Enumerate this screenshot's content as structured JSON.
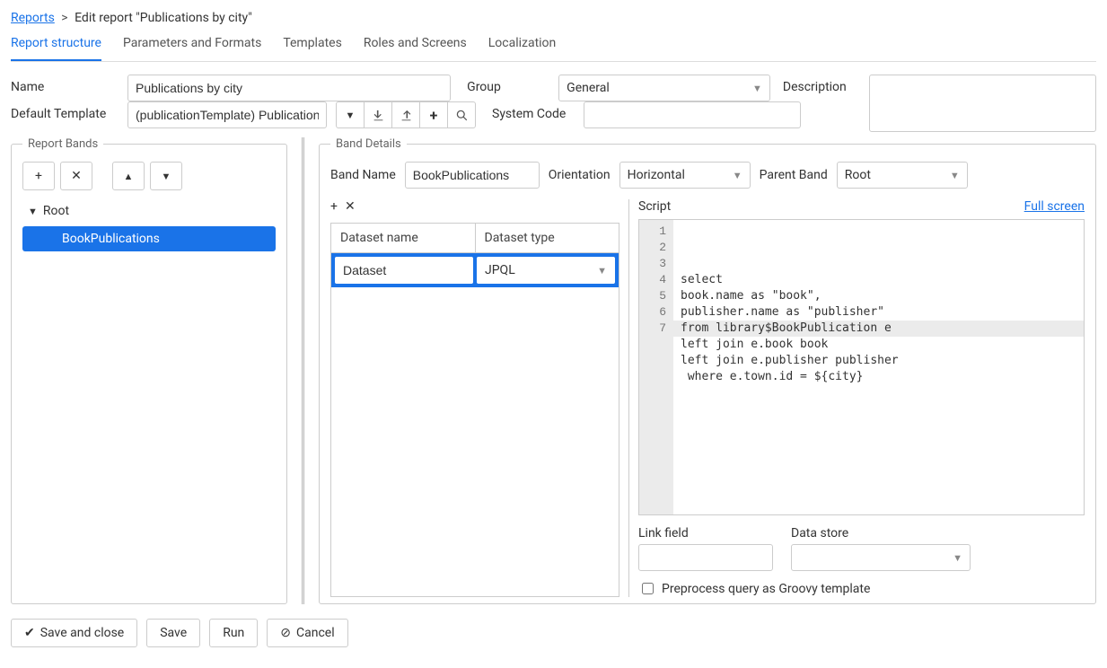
{
  "breadcrumb": {
    "root": "Reports",
    "current": "Edit report \"Publications by city\""
  },
  "tabs": [
    {
      "label": "Report structure",
      "active": true
    },
    {
      "label": "Parameters and Formats",
      "active": false
    },
    {
      "label": "Templates",
      "active": false
    },
    {
      "label": "Roles and Screens",
      "active": false
    },
    {
      "label": "Localization",
      "active": false
    }
  ],
  "fields": {
    "name_label": "Name",
    "name_value": "Publications by city",
    "group_label": "Group",
    "group_value": "General",
    "description_label": "Description",
    "description_value": "",
    "default_template_label": "Default Template",
    "default_template_value": "(publicationTemplate) Publication",
    "system_code_label": "System Code",
    "system_code_value": ""
  },
  "bands": {
    "legend": "Report Bands",
    "root_label": "Root",
    "items": [
      {
        "label": "BookPublications",
        "selected": true
      }
    ]
  },
  "details": {
    "legend": "Band Details",
    "band_name_label": "Band Name",
    "band_name_value": "BookPublications",
    "orientation_label": "Orientation",
    "orientation_value": "Horizontal",
    "parent_band_label": "Parent Band",
    "parent_band_value": "Root",
    "dataset_name_header": "Dataset name",
    "dataset_type_header": "Dataset type",
    "dataset_name_value": "Dataset",
    "dataset_type_value": "JPQL",
    "script_label": "Script",
    "full_screen_label": "Full screen",
    "script_lines": [
      "select",
      "book.name as \"book\",",
      "publisher.name as \"publisher\"",
      "from library$BookPublication e",
      "left join e.book book",
      "left join e.publisher publisher",
      " where e.town.id = ${city}"
    ],
    "highlight_line": 7,
    "link_field_label": "Link field",
    "link_field_value": "",
    "data_store_label": "Data store",
    "data_store_value": "",
    "preprocess_label": "Preprocess query as Groovy template"
  },
  "footer": {
    "save_close": "Save and close",
    "save": "Save",
    "run": "Run",
    "cancel": "Cancel"
  }
}
